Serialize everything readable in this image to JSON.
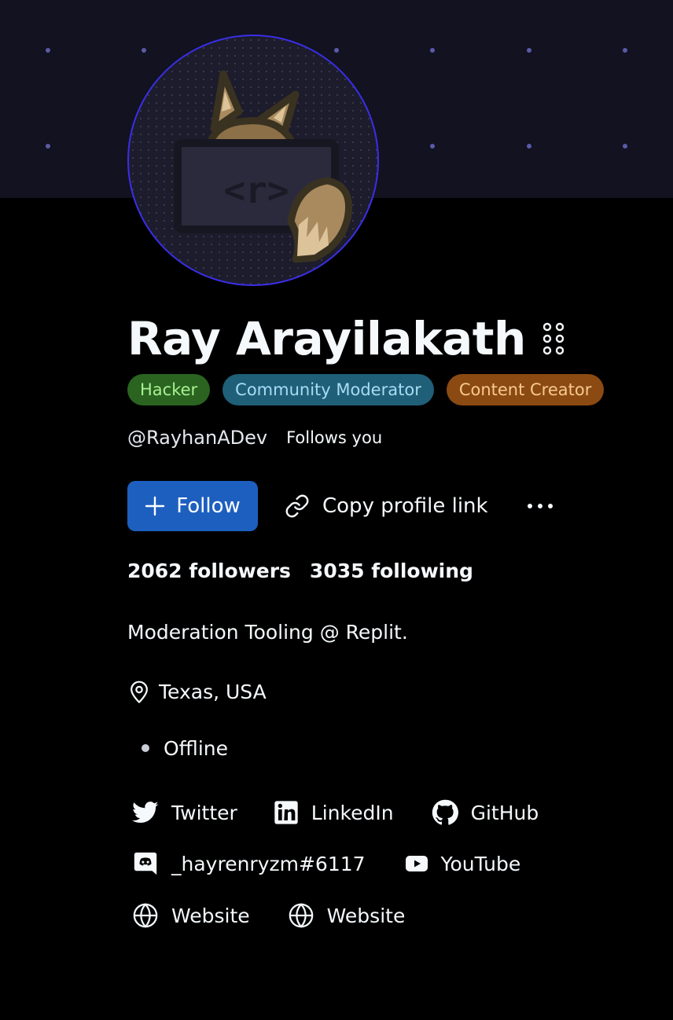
{
  "profile": {
    "name": "Ray Arayilakath",
    "handle": "@RayhanADev",
    "follows_you": "Follows you",
    "bio": "Moderation Tooling @ Replit.",
    "location": "Texas, USA",
    "status": "Offline"
  },
  "badges": [
    {
      "label": "Hacker",
      "color": "#2a6420"
    },
    {
      "label": "Community Moderator",
      "color": "#1f5f78"
    },
    {
      "label": "Content Creator",
      "color": "#8b4a12"
    }
  ],
  "actions": {
    "follow_label": "Follow",
    "copy_link_label": "Copy profile link",
    "more_icon": "more-horizontal-icon"
  },
  "counts": {
    "followers": "2062 followers",
    "following": "3035 following"
  },
  "social": [
    {
      "label": "Twitter",
      "icon": "twitter-icon"
    },
    {
      "label": "LinkedIn",
      "icon": "linkedin-icon"
    },
    {
      "label": "GitHub",
      "icon": "github-icon"
    },
    {
      "label": "_hayrenryzm#6117",
      "icon": "discord-icon"
    },
    {
      "label": "YouTube",
      "icon": "youtube-icon"
    },
    {
      "label": "Website",
      "icon": "globe-icon"
    },
    {
      "label": "Website",
      "icon": "globe-icon"
    }
  ],
  "colors": {
    "accent": "#1d5fbf",
    "avatar_ring": "#3b2ee8",
    "banner": "#121220",
    "background": "#000000"
  }
}
